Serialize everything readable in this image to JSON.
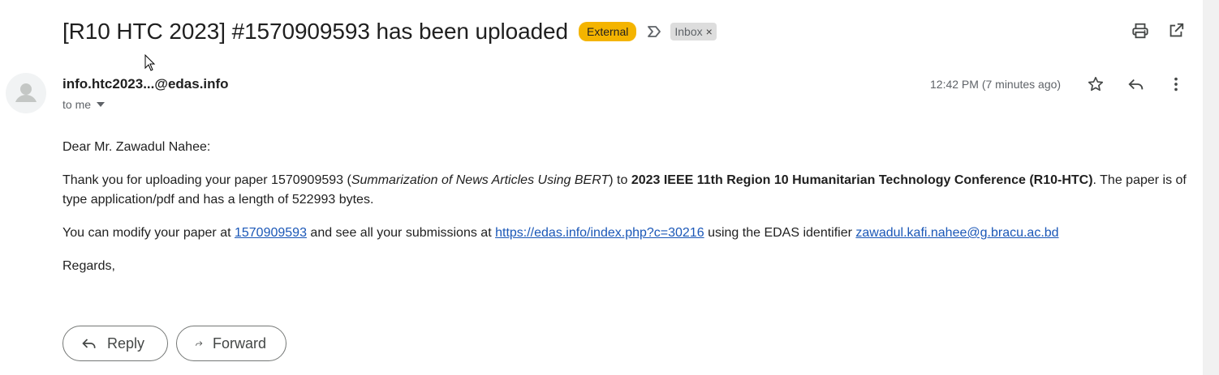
{
  "email": {
    "subject": "[R10 HTC 2023] #1570909593 has been uploaded",
    "badge_external": "External",
    "label_inbox": "Inbox",
    "label_remove": "×",
    "sender": "info.htc2023...@edas.info",
    "recipient": "to me",
    "timestamp": "12:42 PM (7 minutes ago)",
    "greeting": "Dear Mr. Zawadul Nahee:",
    "para1": {
      "t1": "Thank you for uploading your paper 1570909593 (",
      "title": "Summarization of News Articles Using BERT",
      "t2": ") to ",
      "conference": "2023 IEEE 11th Region 10 Humanitarian Technology Conference (R10-HTC)",
      "t3": ". The paper is of type application/pdf and has a length of 522993 bytes."
    },
    "para2": {
      "t1": "You can modify your paper at ",
      "link1": "1570909593",
      "t2": " and see all your submissions at ",
      "link2": "https://edas.info/index.php?c=30216",
      "t3": " using the EDAS identifier ",
      "link3": "zawadul.kafi.nahee@g.bracu.ac.bd"
    },
    "closing": "Regards,"
  },
  "actions": {
    "reply_label": "Reply",
    "forward_label": "Forward"
  },
  "icons": {
    "print": "print-icon",
    "open_new_window": "open-in-new-window-icon",
    "star": "star-icon",
    "reply": "reply-icon",
    "more": "more-vert-icon",
    "importance": "importance-marker-icon",
    "dropdown": "caret-down-icon",
    "avatar": "person-icon"
  },
  "colors": {
    "external_badge": "#f4b400",
    "link": "#1a57b7",
    "inbox_label_bg": "#dddddd"
  }
}
